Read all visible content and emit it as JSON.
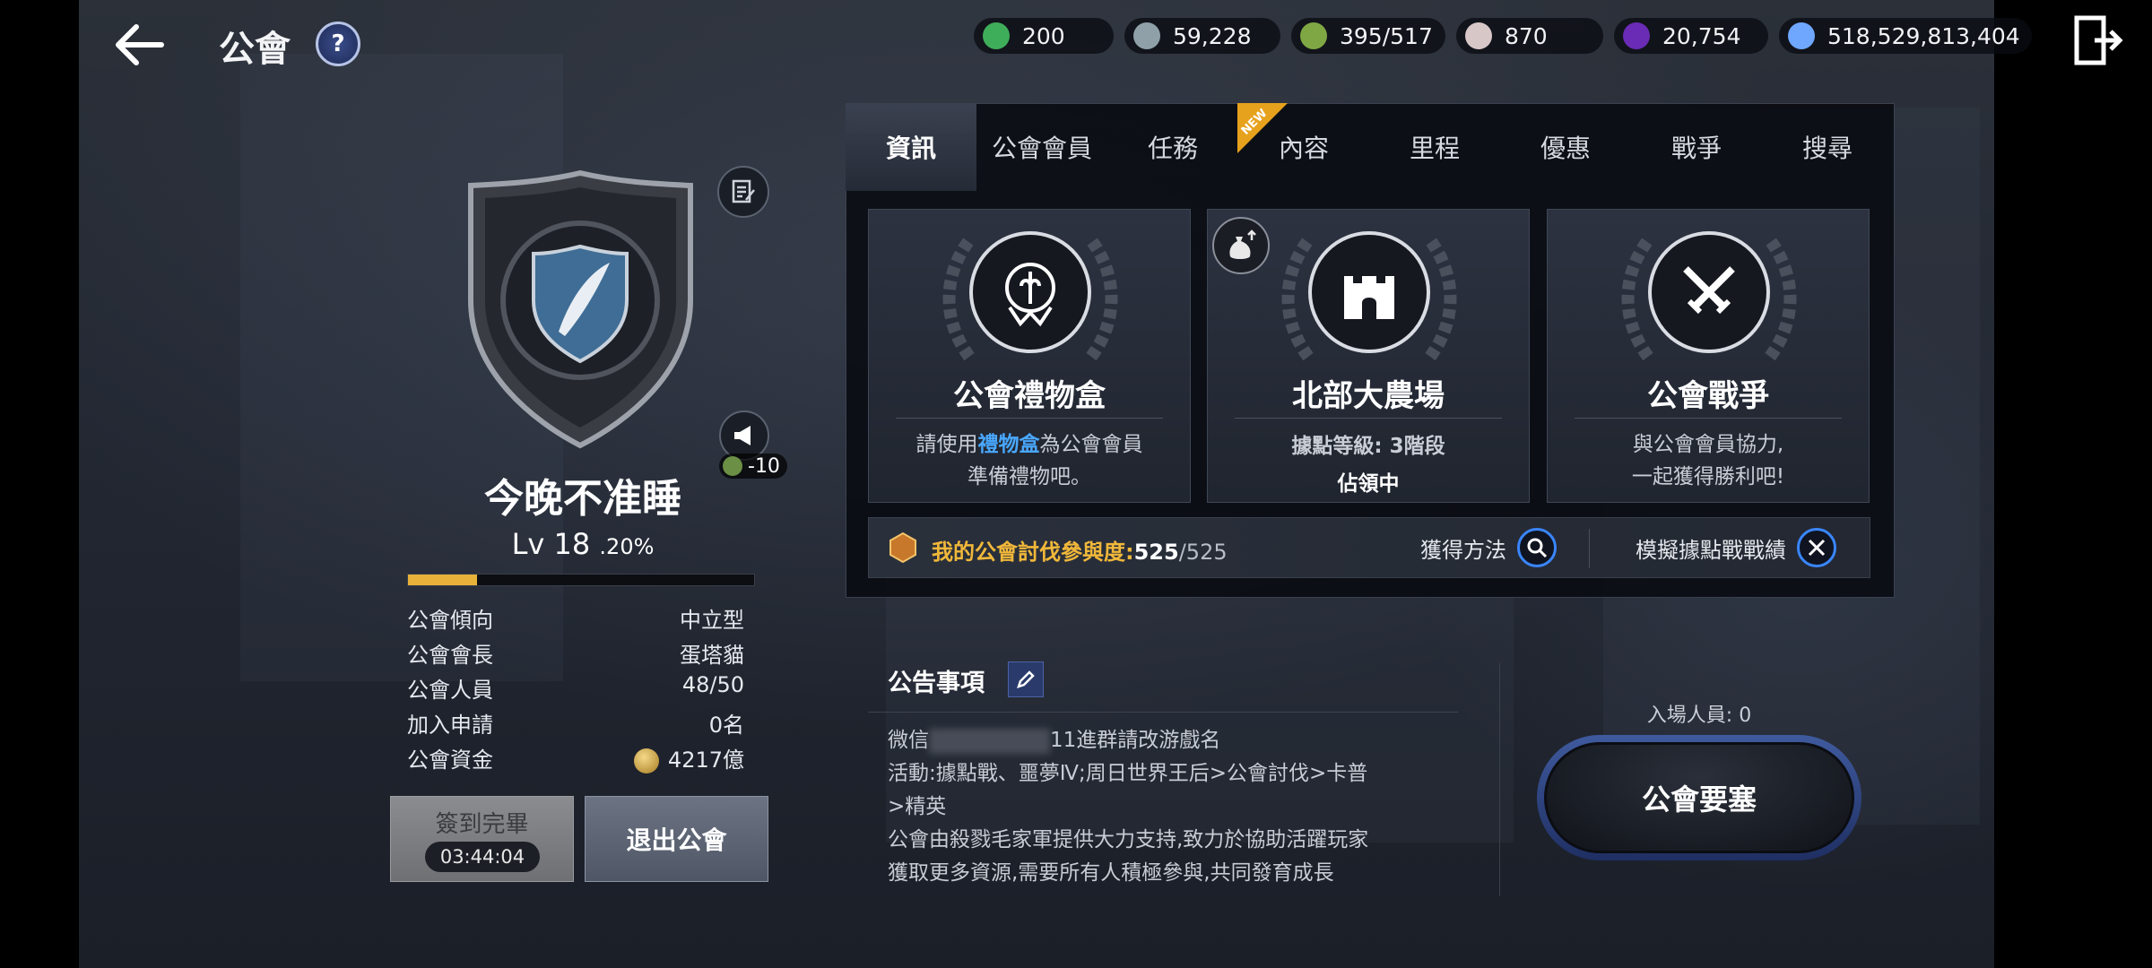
{
  "header": {
    "title": "公會"
  },
  "currencies": [
    {
      "icon": "green-m-coin-icon",
      "value": "200",
      "color": "#3fae5a"
    },
    {
      "icon": "silver-emblem-coin-icon",
      "value": "59,228",
      "color": "#8fa0a8"
    },
    {
      "icon": "green-medal-icon",
      "value": "395/517",
      "color": "#7fa844"
    },
    {
      "icon": "pearl-icon",
      "value": "870",
      "color": "#d8c7c7"
    },
    {
      "icon": "purple-orb-icon",
      "value": "20,754",
      "color": "#6a2bb5"
    },
    {
      "icon": "blue-s-coin-icon",
      "value": "518,529,813,404",
      "color": "#6fa7ff"
    }
  ],
  "guild": {
    "name": "今晚不准睡",
    "level_text": "Lv 18",
    "level_pct": ".20%",
    "xp_progress": 0.2,
    "announce_cost": "-10",
    "stats": [
      {
        "label": "公會傾向",
        "value": "中立型"
      },
      {
        "label": "公會會長",
        "value": "蛋塔貓"
      },
      {
        "label": "公會人員",
        "value": "48/50"
      },
      {
        "label": "加入申請",
        "value": "0名"
      },
      {
        "label": "公會資金",
        "value": "4217億"
      }
    ],
    "checkin_label": "簽到完畢",
    "checkin_timer": "03:44:04",
    "leave_label": "退出公會"
  },
  "tabs": [
    "資訊",
    "公會會員",
    "任務",
    "內容",
    "里程",
    "優惠",
    "戰爭",
    "搜尋"
  ],
  "active_tab": "資訊",
  "new_badge": "NEW",
  "cards": {
    "gift": {
      "title": "公會禮物盒",
      "desc_a": "請使用",
      "desc_hl": "禮物盒",
      "desc_b": "為公會會員",
      "desc_c": "準備禮物吧。"
    },
    "farm": {
      "title": "北部大農場",
      "level": "據點等級: 3階段",
      "status": "佔領中"
    },
    "war": {
      "title": "公會戰爭",
      "desc_a": "與公會會員協力,",
      "desc_b": "一起獲得勝利吧!"
    }
  },
  "participation": {
    "label": "我的公會討伐參與度:",
    "current": "525",
    "max": "/525"
  },
  "how_to_get": "獲得方法",
  "simulate": "模擬據點戰戰績",
  "notice": {
    "title": "公告事項",
    "line1_a": "微信",
    "line1_b": "11進群請改游戲名",
    "line2": "活動:據點戰、噩夢Ⅳ;周日世界王后>公會討伐>卡普",
    "line3": ">精英",
    "line4": "公會由殺戮毛家軍提供大力支持,致力於協助活躍玩家",
    "line5": "獲取更多資源,需要所有人積極參與,共同發育成長"
  },
  "entry_count": "入場人員: 0",
  "fortress_label": "公會要塞"
}
